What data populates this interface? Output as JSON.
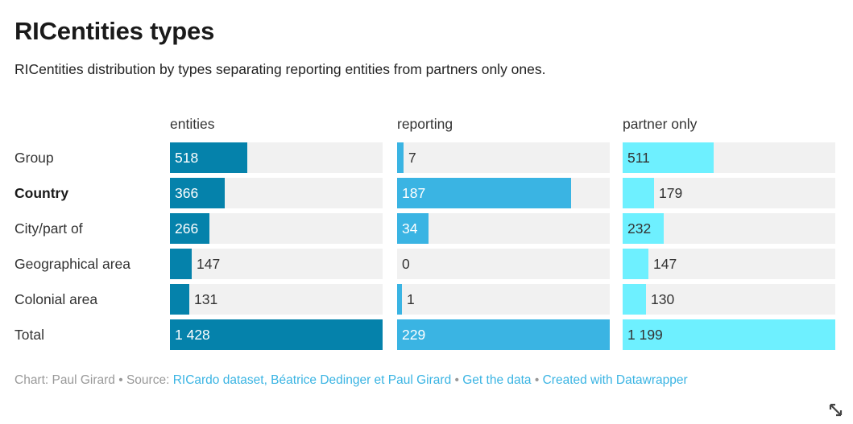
{
  "header": {
    "title": "RICentities types",
    "subtitle": "RICentities distribution by types separating reporting entities from partners only ones."
  },
  "colors": {
    "entities": "#0582ab",
    "reporting": "#3ab4e3",
    "partner_only": "#6ef0ff",
    "track": "#f1f1f1",
    "link": "#3ab4e3",
    "footer_text": "#999999",
    "label_text": "#333333"
  },
  "footer": {
    "credit_prefix": "Chart: Paul Girard",
    "sep1": " • ",
    "source_label": "Source: ",
    "source_link": "RICardo dataset, Béatrice Dedinger et Paul Girard",
    "sep2": " • ",
    "get_data_link": "Get the data",
    "sep3": " • ",
    "datawrapper_link": "Created with Datawrapper"
  },
  "chart_data": {
    "type": "bar",
    "title": "RICentities types",
    "subtitle": "RICentities distribution by types separating reporting entities from partners only ones.",
    "xlabel": "",
    "ylabel": "",
    "grid": false,
    "legend": "none",
    "categories": [
      "Group",
      "Country",
      "City/part of",
      "Geographical area",
      "Colonial area",
      "Total"
    ],
    "highlighted_category": "Country",
    "total_row": "Total",
    "columns": [
      "entities",
      "reporting",
      "partner only"
    ],
    "series": [
      {
        "name": "entities",
        "color": "#0582ab",
        "max": 1428,
        "values": [
          518,
          366,
          266,
          147,
          131,
          1428
        ],
        "labels": [
          "518",
          "366",
          "266",
          "147",
          "131",
          "1 428"
        ]
      },
      {
        "name": "reporting",
        "color": "#3ab4e3",
        "max": 229,
        "values": [
          7,
          187,
          34,
          0,
          1,
          229
        ],
        "labels": [
          "7",
          "187",
          "34",
          "0",
          "1",
          "229"
        ]
      },
      {
        "name": "partner only",
        "color": "#6ef0ff",
        "max": 1199,
        "values": [
          511,
          179,
          232,
          147,
          130,
          1199
        ],
        "labels": [
          "511",
          "179",
          "232",
          "147",
          "130",
          "1 199"
        ]
      }
    ]
  },
  "icons": {
    "resize": "resize-handle-icon"
  }
}
